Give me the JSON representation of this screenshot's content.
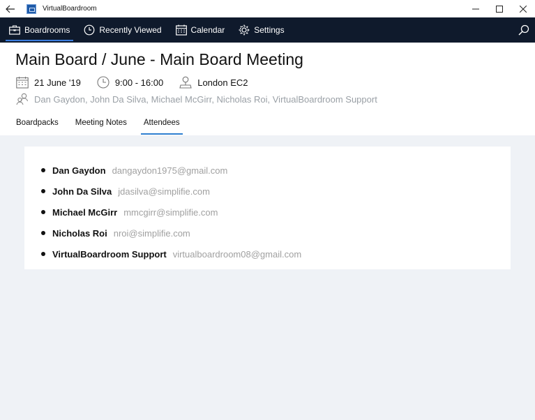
{
  "window": {
    "title": "VirtualBoardroom"
  },
  "nav": {
    "items": [
      {
        "label": "Boardrooms",
        "icon": "briefcase-icon",
        "active": true
      },
      {
        "label": "Recently Viewed",
        "icon": "clock-icon"
      },
      {
        "label": "Calendar",
        "icon": "calendar-icon"
      },
      {
        "label": "Settings",
        "icon": "gear-icon"
      }
    ]
  },
  "meeting": {
    "title": "Main Board / June - Main Board Meeting",
    "date": "21 June '19",
    "time": "9:00 - 16:00",
    "location": "London EC2",
    "attendees_summary": "Dan Gaydon, John Da Silva, Michael McGirr, Nicholas Roi, VirtualBoardroom Support"
  },
  "tabs": [
    {
      "label": "Boardpacks"
    },
    {
      "label": "Meeting Notes"
    },
    {
      "label": "Attendees",
      "active": true
    }
  ],
  "attendees": [
    {
      "name": "Dan Gaydon",
      "email": "dangaydon1975@gmail.com"
    },
    {
      "name": "John Da Silva",
      "email": "jdasilva@simplifie.com"
    },
    {
      "name": "Michael McGirr",
      "email": "mmcgirr@simplifie.com"
    },
    {
      "name": "Nicholas Roi",
      "email": "nroi@simplifie.com"
    },
    {
      "name": "VirtualBoardroom Support",
      "email": "virtualboardroom08@gmail.com"
    }
  ],
  "colors": {
    "nav_bg": "#0f1a2c",
    "accent": "#2f7fd0",
    "page_bg": "#eff2f6"
  }
}
